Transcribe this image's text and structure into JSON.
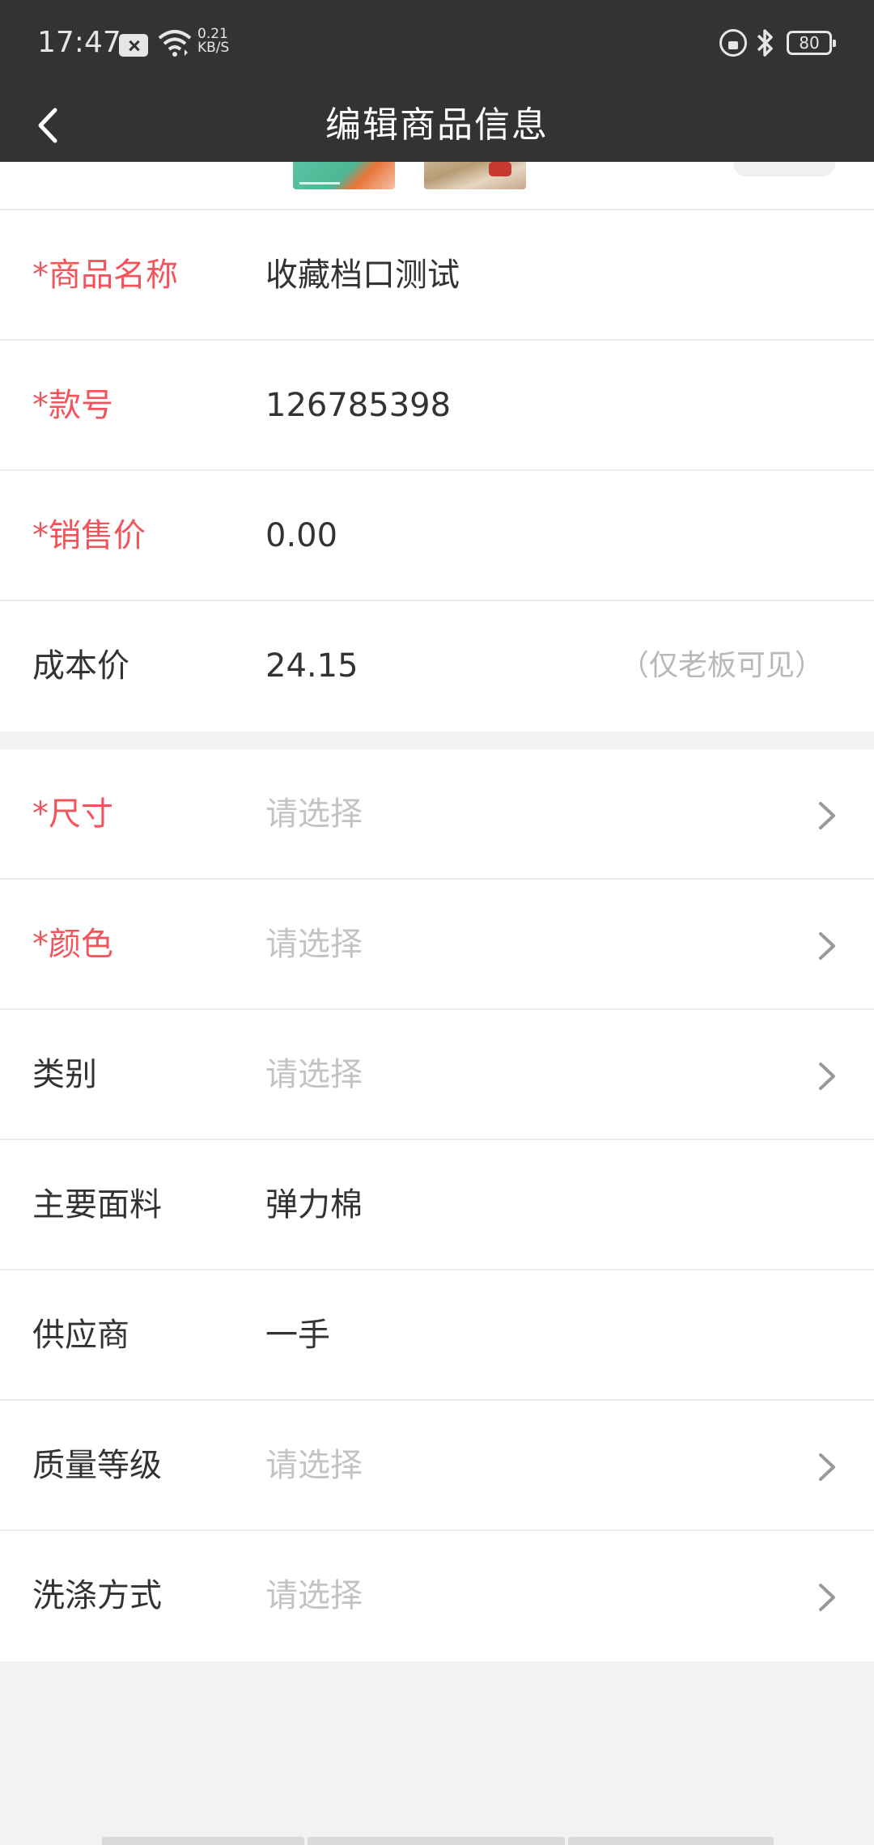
{
  "status_bar": {
    "time": "17:47",
    "net_speed_value": "0.21",
    "net_speed_unit": "KB/S",
    "battery": "80",
    "icons": [
      "message-blocked-icon",
      "wifi-icon",
      "lock-rotation-icon",
      "bluetooth-icon",
      "battery-icon"
    ]
  },
  "nav": {
    "title": "编辑商品信息",
    "back_icon": "chevron-left-icon"
  },
  "colors": {
    "header_bg": "#333333",
    "required_label": "#f2545b",
    "placeholder": "#c3c3c3",
    "page_bg": "#f1f2f4"
  },
  "form": {
    "basic": [
      {
        "label": "*商品名称",
        "value": "收藏档口测试",
        "required": true
      },
      {
        "label": "*款号",
        "value": "126785398",
        "required": true
      },
      {
        "label": "*销售价",
        "value": "0.00",
        "required": true
      },
      {
        "label": "成本价",
        "value": "24.15",
        "hint": "（仅老板可见）",
        "required": false
      }
    ],
    "attributes": [
      {
        "label": "*尺寸",
        "value": "请选择",
        "placeholder": true,
        "required": true,
        "has_arrow": true
      },
      {
        "label": "*颜色",
        "value": "请选择",
        "placeholder": true,
        "required": true,
        "has_arrow": true
      },
      {
        "label": "类别",
        "value": "请选择",
        "placeholder": true,
        "required": false,
        "has_arrow": true
      },
      {
        "label": "主要面料",
        "value": "弹力棉",
        "placeholder": false,
        "required": false,
        "has_arrow": false
      },
      {
        "label": "供应商",
        "value": "一手",
        "placeholder": false,
        "required": false,
        "has_arrow": false
      },
      {
        "label": "质量等级",
        "value": "请选择",
        "placeholder": true,
        "required": false,
        "has_arrow": true
      },
      {
        "label": "洗涤方式",
        "value": "请选择",
        "placeholder": true,
        "required": false,
        "has_arrow": true
      }
    ]
  }
}
